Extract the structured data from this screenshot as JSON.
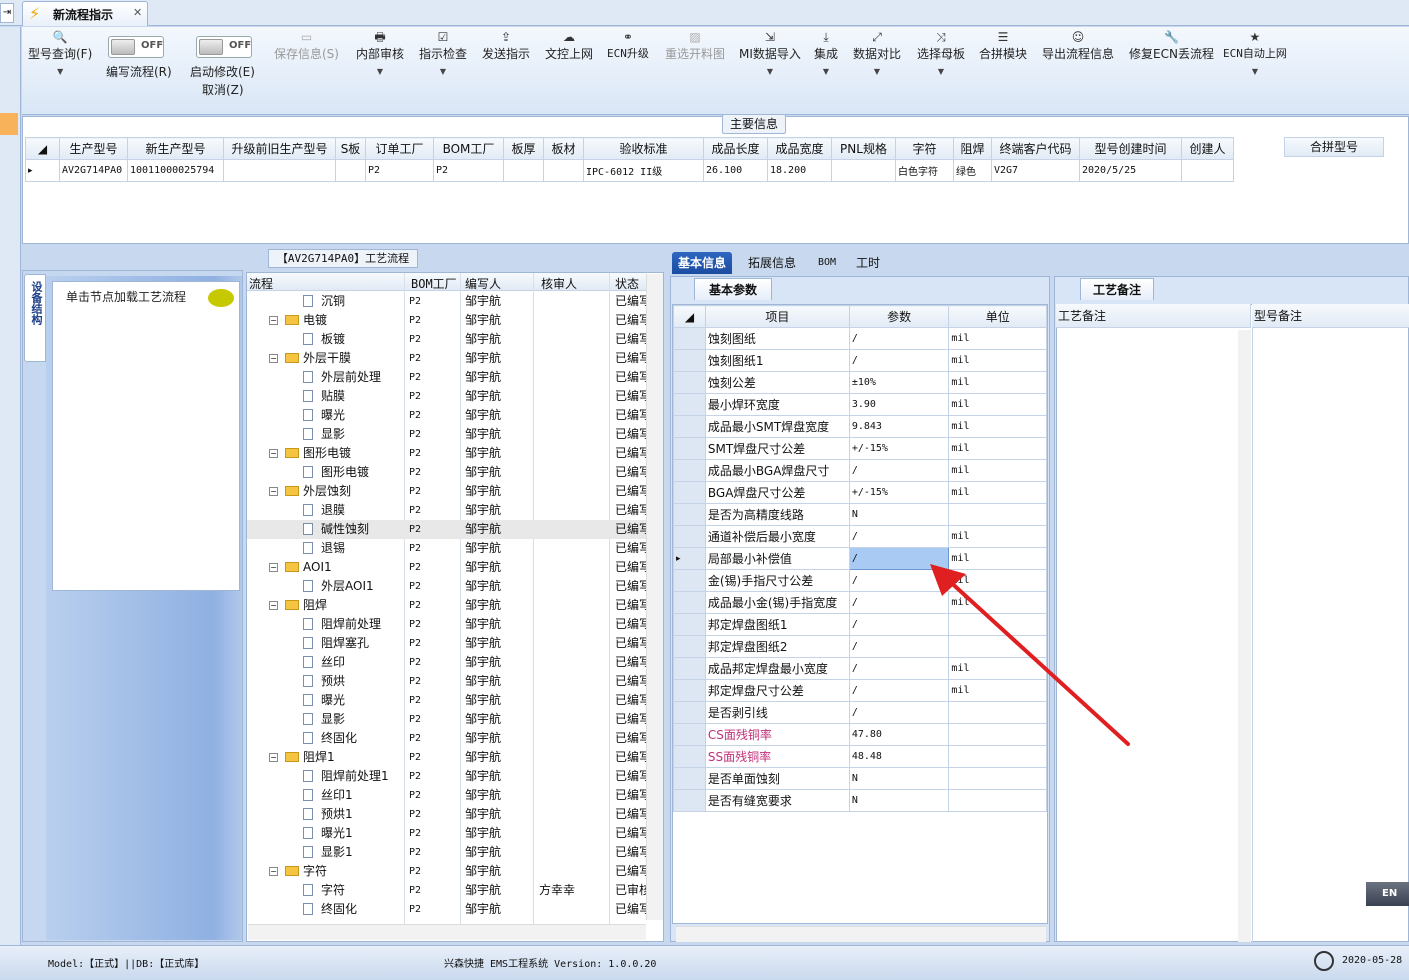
{
  "tabs": {
    "document_tab": "新流程指示"
  },
  "ribbon": {
    "query": "型号查询(F)",
    "write_toggle": "OFF",
    "write": "编写流程(R)",
    "modify_toggle": "OFF",
    "modify_line1": "启动修改(E)",
    "modify_line2": "取消(Z)",
    "save": "保存信息(S)",
    "internal_review": "内部审核",
    "check": "指示检查",
    "send": "发送指示",
    "upload_doc": "文控上网",
    "ecn_upgrade": "ECN升级",
    "reselect": "重选开料图",
    "mi_import": "MI数据导入",
    "integrate": "集成",
    "compare": "数据对比",
    "select_mother": "选择母板",
    "merge_module": "合拼模块",
    "export": "导出流程信息",
    "repair_ecn": "修复ECN丢流程",
    "ecn_auto": "ECN自动上网"
  },
  "main_info": {
    "title": "主要信息",
    "columns": [
      "生产型号",
      "新生产型号",
      "升级前旧生产型号",
      "S板",
      "订单工厂",
      "BOM工厂",
      "板厚",
      "板材",
      "验收标准",
      "成品长度",
      "成品宽度",
      "PNL规格",
      "字符",
      "阻焊",
      "终端客户代码",
      "型号创建时间",
      "创建人"
    ],
    "row": [
      "AV2G714PA0",
      "10011000025794",
      "",
      "",
      "P2",
      "P2",
      "",
      "",
      "IPC-6012 II级",
      "26.100",
      "18.200",
      "",
      "白色字符",
      "绿色",
      "V2G7",
      "2020/5/25",
      ""
    ],
    "merge_header": "合拼型号"
  },
  "left_panel": {
    "vertical_tab": "设备结构",
    "hint": "单击节点加载工艺流程"
  },
  "process_tree": {
    "title": "【AV2G714PA0】工艺流程",
    "headers": {
      "flow": "流程",
      "bom": "BOM工厂",
      "writer": "编写人",
      "checker": "核审人",
      "status": "状态"
    },
    "rows": [
      {
        "name": "沉铜",
        "level": 1,
        "bom": "P2",
        "writer": "邹宇航",
        "checker": "",
        "status": "已编写"
      },
      {
        "name": "电镀",
        "level": 0,
        "bom": "P2",
        "writer": "邹宇航",
        "checker": "",
        "status": "已编写"
      },
      {
        "name": "板镀",
        "level": 1,
        "bom": "P2",
        "writer": "邹宇航",
        "checker": "",
        "status": "已编写"
      },
      {
        "name": "外层干膜",
        "level": 0,
        "bom": "P2",
        "writer": "邹宇航",
        "checker": "",
        "status": "已编写"
      },
      {
        "name": "外层前处理",
        "level": 1,
        "bom": "P2",
        "writer": "邹宇航",
        "checker": "",
        "status": "已编写"
      },
      {
        "name": "贴膜",
        "level": 1,
        "bom": "P2",
        "writer": "邹宇航",
        "checker": "",
        "status": "已编写"
      },
      {
        "name": "曝光",
        "level": 1,
        "bom": "P2",
        "writer": "邹宇航",
        "checker": "",
        "status": "已编写"
      },
      {
        "name": "显影",
        "level": 1,
        "bom": "P2",
        "writer": "邹宇航",
        "checker": "",
        "status": "已编写"
      },
      {
        "name": "图形电镀",
        "level": 0,
        "bom": "P2",
        "writer": "邹宇航",
        "checker": "",
        "status": "已编写"
      },
      {
        "name": "图形电镀",
        "level": 1,
        "bom": "P2",
        "writer": "邹宇航",
        "checker": "",
        "status": "已编写"
      },
      {
        "name": "外层蚀刻",
        "level": 0,
        "bom": "P2",
        "writer": "邹宇航",
        "checker": "",
        "status": "已编写"
      },
      {
        "name": "退膜",
        "level": 1,
        "bom": "P2",
        "writer": "邹宇航",
        "checker": "",
        "status": "已编写"
      },
      {
        "name": "碱性蚀刻",
        "level": 1,
        "bom": "P2",
        "writer": "邹宇航",
        "checker": "",
        "status": "已编写",
        "selected": true
      },
      {
        "name": "退锡",
        "level": 1,
        "bom": "P2",
        "writer": "邹宇航",
        "checker": "",
        "status": "已编写"
      },
      {
        "name": "AOI1",
        "level": 0,
        "bom": "P2",
        "writer": "邹宇航",
        "checker": "",
        "status": "已编写"
      },
      {
        "name": "外层AOI1",
        "level": 1,
        "bom": "P2",
        "writer": "邹宇航",
        "checker": "",
        "status": "已编写"
      },
      {
        "name": "阻焊",
        "level": 0,
        "bom": "P2",
        "writer": "邹宇航",
        "checker": "",
        "status": "已编写"
      },
      {
        "name": "阻焊前处理",
        "level": 1,
        "bom": "P2",
        "writer": "邹宇航",
        "checker": "",
        "status": "已编写"
      },
      {
        "name": "阻焊塞孔",
        "level": 1,
        "bom": "P2",
        "writer": "邹宇航",
        "checker": "",
        "status": "已编写"
      },
      {
        "name": "丝印",
        "level": 1,
        "bom": "P2",
        "writer": "邹宇航",
        "checker": "",
        "status": "已编写"
      },
      {
        "name": "预烘",
        "level": 1,
        "bom": "P2",
        "writer": "邹宇航",
        "checker": "",
        "status": "已编写"
      },
      {
        "name": "曝光",
        "level": 1,
        "bom": "P2",
        "writer": "邹宇航",
        "checker": "",
        "status": "已编写"
      },
      {
        "name": "显影",
        "level": 1,
        "bom": "P2",
        "writer": "邹宇航",
        "checker": "",
        "status": "已编写"
      },
      {
        "name": "终固化",
        "level": 1,
        "bom": "P2",
        "writer": "邹宇航",
        "checker": "",
        "status": "已编写"
      },
      {
        "name": "阻焊1",
        "level": 0,
        "bom": "P2",
        "writer": "邹宇航",
        "checker": "",
        "status": "已编写"
      },
      {
        "name": "阻焊前处理1",
        "level": 1,
        "bom": "P2",
        "writer": "邹宇航",
        "checker": "",
        "status": "已编写"
      },
      {
        "name": "丝印1",
        "level": 1,
        "bom": "P2",
        "writer": "邹宇航",
        "checker": "",
        "status": "已编写"
      },
      {
        "name": "预烘1",
        "level": 1,
        "bom": "P2",
        "writer": "邹宇航",
        "checker": "",
        "status": "已编写"
      },
      {
        "name": "曝光1",
        "level": 1,
        "bom": "P2",
        "writer": "邹宇航",
        "checker": "",
        "status": "已编写"
      },
      {
        "name": "显影1",
        "level": 1,
        "bom": "P2",
        "writer": "邹宇航",
        "checker": "",
        "status": "已编写"
      },
      {
        "name": "字符",
        "level": 0,
        "bom": "P2",
        "writer": "邹宇航",
        "checker": "",
        "status": "已编写"
      },
      {
        "name": "字符",
        "level": 1,
        "bom": "P2",
        "writer": "邹宇航",
        "checker": "方幸幸",
        "status": "已审核"
      },
      {
        "name": "终固化",
        "level": 1,
        "bom": "P2",
        "writer": "邹宇航",
        "checker": "",
        "status": "已编写"
      }
    ]
  },
  "right_tabs": [
    "基本信息",
    "拓展信息",
    "BOM",
    "工时"
  ],
  "basic_params": {
    "tab": "基本参数",
    "headers": {
      "item": "项目",
      "param": "参数",
      "unit": "单位"
    },
    "rows": [
      {
        "item": "蚀刻图纸",
        "param": "/",
        "unit": "mil"
      },
      {
        "item": "蚀刻图纸1",
        "param": "/",
        "unit": "mil"
      },
      {
        "item": "蚀刻公差",
        "param": "±10%",
        "unit": "mil"
      },
      {
        "item": "最小焊环宽度",
        "param": "3.90",
        "unit": "mil"
      },
      {
        "item": "成品最小SMT焊盘宽度",
        "param": "9.843",
        "unit": "mil"
      },
      {
        "item": "SMT焊盘尺寸公差",
        "param": "+/-15%",
        "unit": "mil"
      },
      {
        "item": "成品最小BGA焊盘尺寸",
        "param": "/",
        "unit": "mil"
      },
      {
        "item": "BGA焊盘尺寸公差",
        "param": "+/-15%",
        "unit": "mil"
      },
      {
        "item": "是否为高精度线路",
        "param": "N",
        "unit": ""
      },
      {
        "item": "通道补偿后最小宽度",
        "param": "/",
        "unit": "mil"
      },
      {
        "item": "局部最小补偿值",
        "param": "/",
        "unit": "mil",
        "current": true
      },
      {
        "item": "金(锡)手指尺寸公差",
        "param": "/",
        "unit": "mil"
      },
      {
        "item": "成品最小金(锡)手指宽度",
        "param": "/",
        "unit": "mil"
      },
      {
        "item": "邦定焊盘图纸1",
        "param": "/",
        "unit": ""
      },
      {
        "item": "邦定焊盘图纸2",
        "param": "/",
        "unit": ""
      },
      {
        "item": "成品邦定焊盘最小宽度",
        "param": "/",
        "unit": "mil"
      },
      {
        "item": "邦定焊盘尺寸公差",
        "param": "/",
        "unit": "mil"
      },
      {
        "item": "是否剥引线",
        "param": "/",
        "unit": ""
      },
      {
        "item": "CS面残铜率",
        "param": "47.80",
        "unit": "",
        "highlight": "#c0307a"
      },
      {
        "item": "SS面残铜率",
        "param": "48.48",
        "unit": "",
        "highlight": "#c0307a"
      },
      {
        "item": "是否单面蚀刻",
        "param": "N",
        "unit": ""
      },
      {
        "item": "是否有缝宽要求",
        "param": "N",
        "unit": ""
      }
    ]
  },
  "process_notes": {
    "tab": "工艺备注",
    "col1": "工艺备注",
    "col2": "型号备注"
  },
  "ime": {
    "badge": "EN"
  },
  "statusbar": {
    "left": "Model:【正式】||DB:【正式库】",
    "center": "兴森快捷 EMS工程系统 Version: 1.0.0.20",
    "date": "2020-05-28"
  },
  "colors": {
    "accent": "#1b4ca0",
    "arrow": "#e02020",
    "highlight_text": "#c0307a"
  }
}
